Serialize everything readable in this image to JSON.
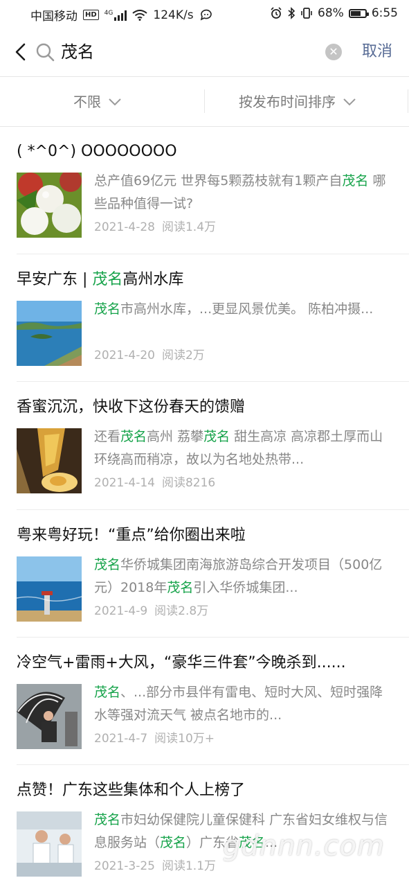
{
  "status_bar": {
    "carrier": "中国移动",
    "hd": "HD",
    "net": "4G",
    "speed": "124K/s",
    "battery_pct": "68%",
    "time": "6:55",
    "battery_level": 0.68
  },
  "search": {
    "query": "茂名",
    "cancel_label": "取消"
  },
  "filters": {
    "scope": "不限",
    "sort": "按发布时间排序"
  },
  "results": [
    {
      "title": [
        {
          "t": "( *^0^) OOOOOOOO",
          "hl": false
        }
      ],
      "snippet": [
        {
          "t": "总产值69亿元 世界每5颗荔枝就有1颗产自",
          "hl": false
        },
        {
          "t": "茂名",
          "hl": true
        },
        {
          "t": " 哪些品种值得一试?",
          "hl": false
        }
      ],
      "date": "2021-4-28",
      "reads": "阅读1.4万",
      "thumb": "lychee"
    },
    {
      "title": [
        {
          "t": "早安广东 | ",
          "hl": false
        },
        {
          "t": "茂名",
          "hl": true
        },
        {
          "t": "高州水库",
          "hl": false
        }
      ],
      "snippet": [
        {
          "t": "茂名",
          "hl": true
        },
        {
          "t": "市高州水库，...更显风景优美。 陈柏冲摄...",
          "hl": false
        }
      ],
      "date": "2021-4-20",
      "reads": "阅读2万",
      "thumb": "reservoir"
    },
    {
      "title": [
        {
          "t": "香蜜沉沉，快收下这份春天的馈赠",
          "hl": false
        }
      ],
      "snippet": [
        {
          "t": "还看",
          "hl": false
        },
        {
          "t": "茂名",
          "hl": true
        },
        {
          "t": "高州 荔攀",
          "hl": false
        },
        {
          "t": "茂名",
          "hl": true
        },
        {
          "t": " 甜生高凉 高凉郡土厚而山环绕高而稍凉，故以为名地处热带...",
          "hl": false
        }
      ],
      "date": "2021-4-14",
      "reads": "阅读8216",
      "thumb": "honey"
    },
    {
      "title": [
        {
          "t": "粤来粤好玩！“重点”给你圈出来啦",
          "hl": false
        }
      ],
      "snippet": [
        {
          "t": "茂名",
          "hl": true
        },
        {
          "t": "华侨城集团南海旅游岛综合开发项目（500亿元）2018年",
          "hl": false
        },
        {
          "t": "茂名",
          "hl": true
        },
        {
          "t": "引入华侨城集团...",
          "hl": false
        }
      ],
      "date": "2021-4-9",
      "reads": "阅读2.8万",
      "thumb": "sea"
    },
    {
      "title": [
        {
          "t": "冷空气+雷雨+大风，“豪华三件套”今晚杀到......",
          "hl": false
        }
      ],
      "snippet": [
        {
          "t": "茂名",
          "hl": true
        },
        {
          "t": "、...部分市县伴有雷电、短时大风、短时强降水等强对流天气 被点名地市的...",
          "hl": false
        }
      ],
      "date": "2021-4-7",
      "reads": "阅读10万+",
      "thumb": "umbrella"
    },
    {
      "title": [
        {
          "t": "点赞！广东这些集体和个人上榜了",
          "hl": false
        }
      ],
      "snippet": [
        {
          "t": "茂名",
          "hl": true
        },
        {
          "t": "市妇幼保健院儿童保健科 广东省妇女维权与信息服务站（",
          "hl": false
        },
        {
          "t": "茂名",
          "hl": true
        },
        {
          "t": "）广东省",
          "hl": false
        },
        {
          "t": "茂名",
          "hl": true
        },
        {
          "t": "...",
          "hl": false
        }
      ],
      "date": "2021-3-25",
      "reads": "阅读1.1万",
      "thumb": "lab"
    }
  ],
  "watermark": "gdnnn.com"
}
